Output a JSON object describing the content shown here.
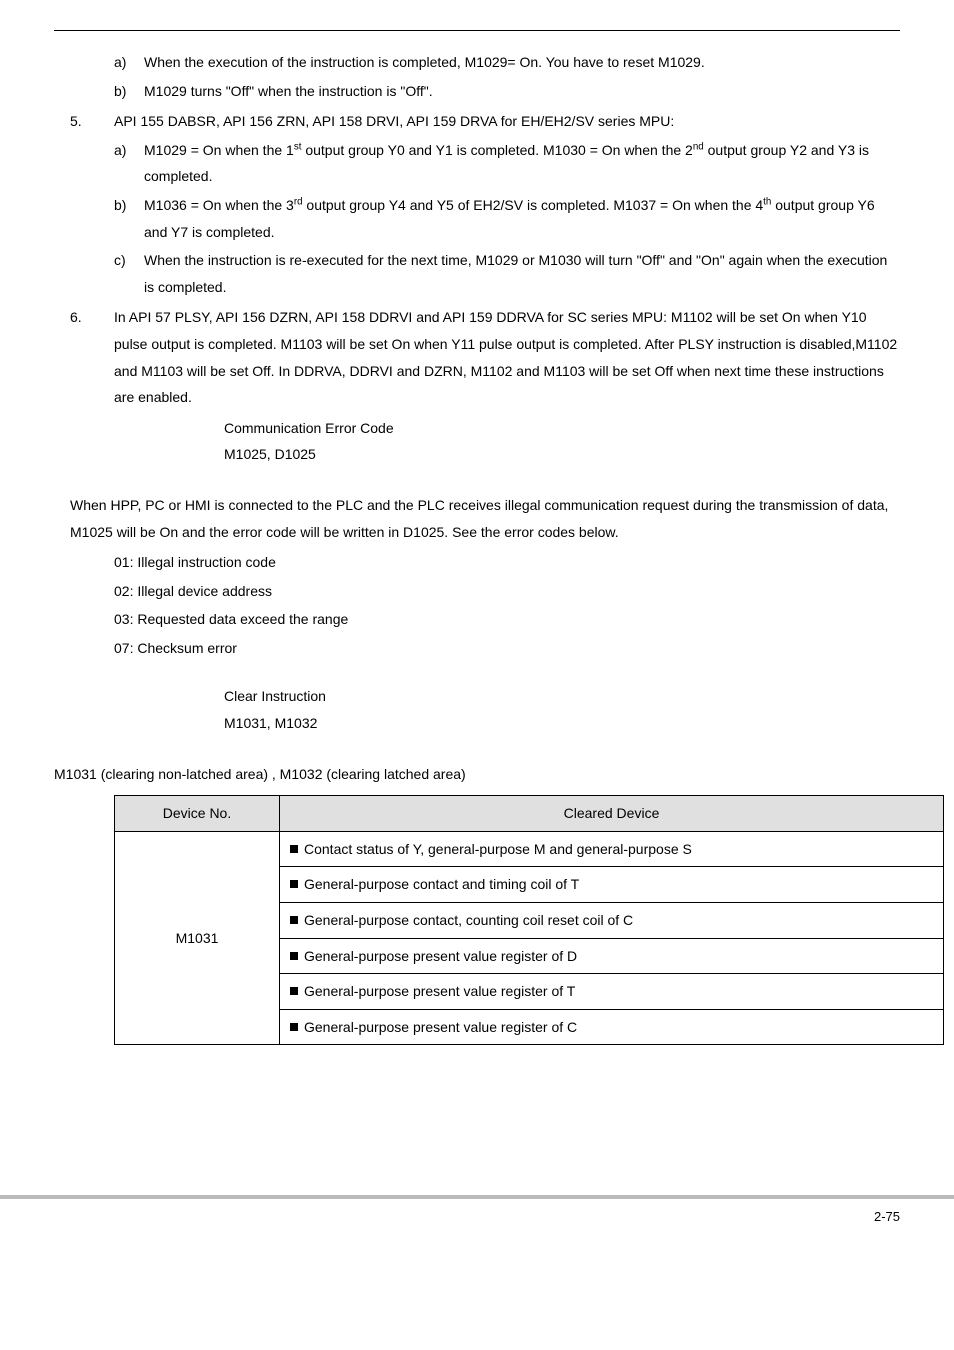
{
  "sec1": {
    "a": "When the execution of the instruction is completed, M1029= On. You have to reset M1029.",
    "b": "M1029 turns \"Off\" when the instruction is \"Off\"."
  },
  "item5": {
    "intro": "API 155 DABSR, API 156 ZRN, API 158 DRVI, API 159 DRVA for EH/EH2/SV series MPU:",
    "a_pre": "M1029 = On when the 1",
    "a_sup1": "st",
    "a_mid": " output group Y0 and Y1 is completed. M1030 = On when the 2",
    "a_sup2": "nd",
    "a_post": " output group Y2 and Y3 is completed.",
    "b_pre": "M1036 = On when the 3",
    "b_sup1": "rd",
    "b_mid": " output group Y4 and Y5 of EH2/SV is completed. M1037 = On when the 4",
    "b_sup2": "th",
    "b_post": " output group Y6 and Y7 is completed.",
    "c": "When the instruction is re-executed for the next time, M1029 or M1030 will turn \"Off\" and \"On\" again when the execution is completed."
  },
  "item6": "In API 57 PLSY, API 156 DZRN, API 158 DDRVI and API 159 DDRVA for SC series MPU: M1102 will be set On when Y10 pulse output is completed. M1103 will be set On when Y11 pulse output is completed. After PLSY instruction is disabled,M1102 and M1103 will be set Off. In DDRVA, DDRVI and DZRN, M1102 and M1103 will be set Off when next time these instructions are enabled.",
  "commErr": {
    "title": "Communication Error Code",
    "refs": "M1025, D1025"
  },
  "commPara": "When HPP, PC or HMI is connected to the PLC and the PLC receives illegal communication request during the transmission of data, M1025 will be On and the error code will be written in D1025. See the error codes below.",
  "codes": {
    "c01": "01: Illegal instruction code",
    "c02": "02: Illegal device address",
    "c03": "03: Requested data exceed the range",
    "c07": "07: Checksum error"
  },
  "clearInstr": {
    "title": "Clear Instruction",
    "refs": "M1031, M1032"
  },
  "clearPara": "M1031 (clearing non-latched area) , M1032 (clearing latched area)",
  "table": {
    "h1": "Device No.",
    "h2": "Cleared Device",
    "device": "M1031",
    "r1": "Contact status of Y, general-purpose M and general-purpose S",
    "r2": "General-purpose contact and timing coil of T",
    "r3": "General-purpose contact, counting coil reset coil of C",
    "r4": "General-purpose present value register of D",
    "r5": "General-purpose present value register of T",
    "r6": "General-purpose present value register of C"
  },
  "markers": {
    "a": "a)",
    "b": "b)",
    "c": "c)",
    "n5": "5.",
    "n6": "6."
  },
  "pageNum": "2-75"
}
